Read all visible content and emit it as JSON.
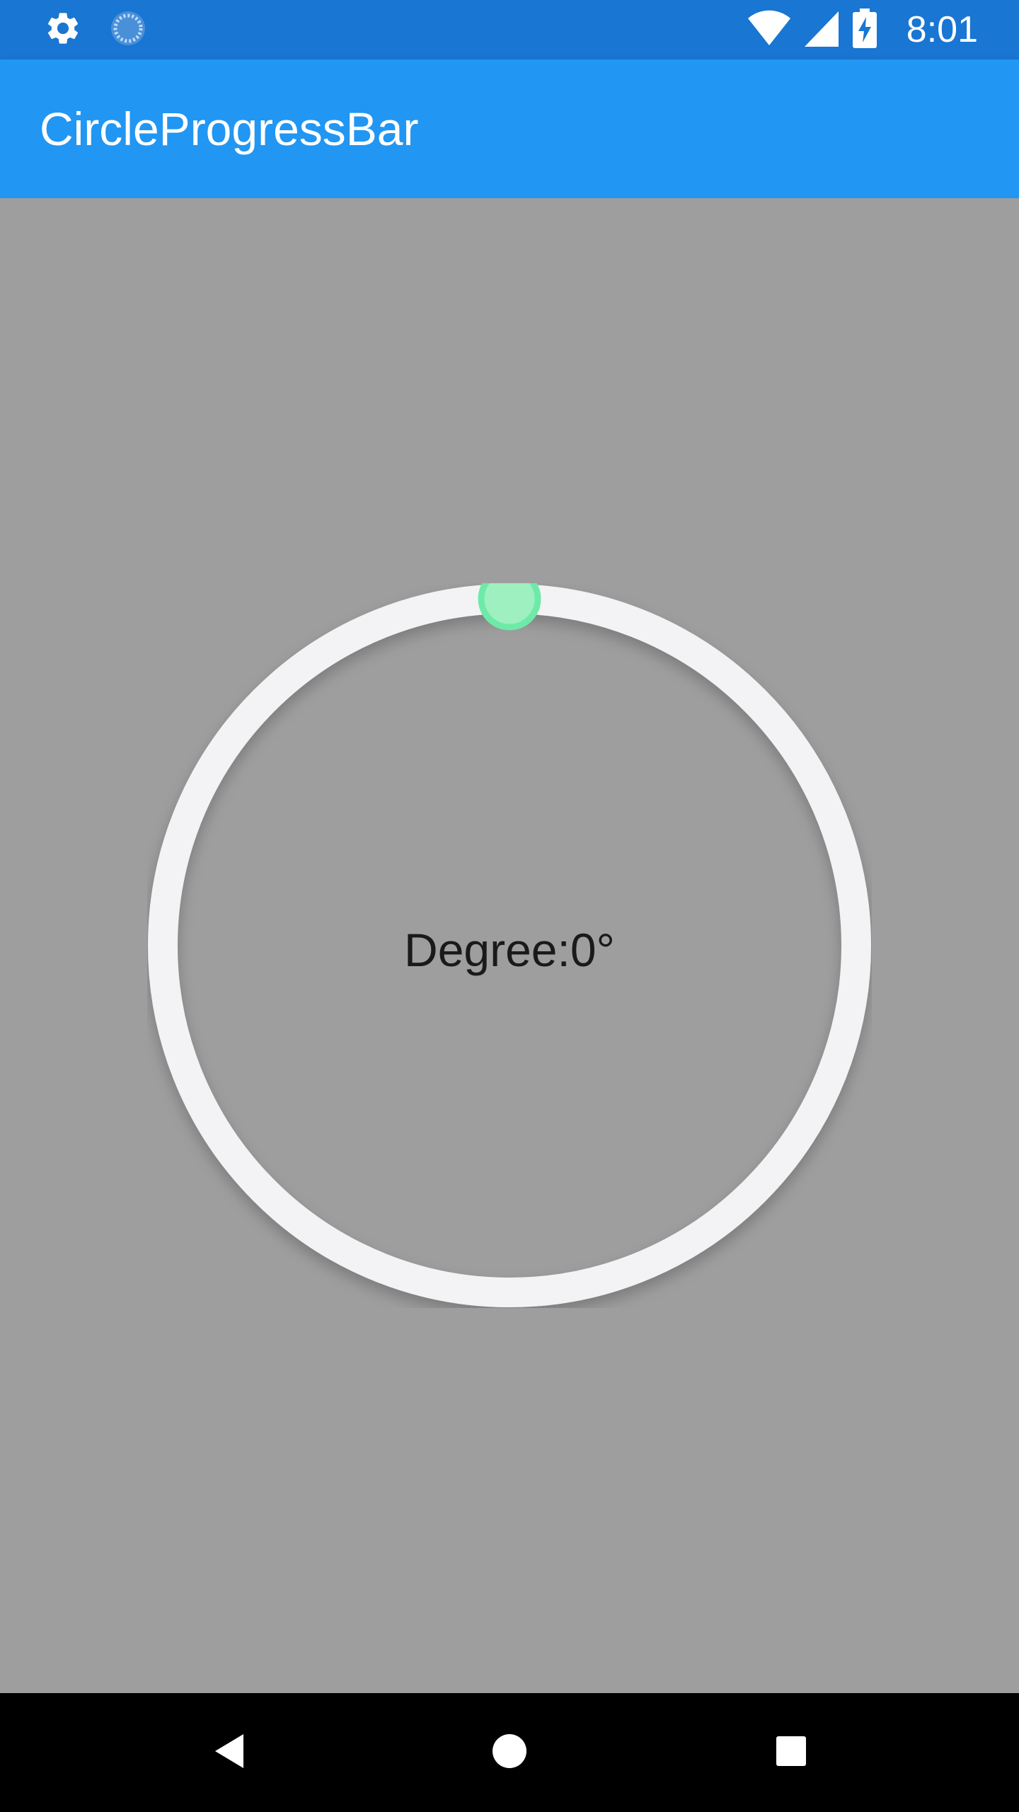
{
  "status_bar": {
    "time": "8:01",
    "left_icons": [
      "gear-icon",
      "sync-icon"
    ],
    "right_icons": [
      "wifi-icon",
      "cell-signal-icon",
      "battery-charging-icon"
    ]
  },
  "app_bar": {
    "title": "CircleProgressBar"
  },
  "progress": {
    "label": "Degree:0°",
    "degree": 0,
    "track_color": "#f3f3f5",
    "thumb_color": "#69f0ae"
  },
  "nav_bar": {
    "buttons": [
      "back-icon",
      "home-icon",
      "recents-icon"
    ]
  },
  "colors": {
    "status_bar": "#1976d2",
    "app_bar": "#2196f3",
    "background": "#9e9e9e",
    "nav_bar": "#000000"
  }
}
